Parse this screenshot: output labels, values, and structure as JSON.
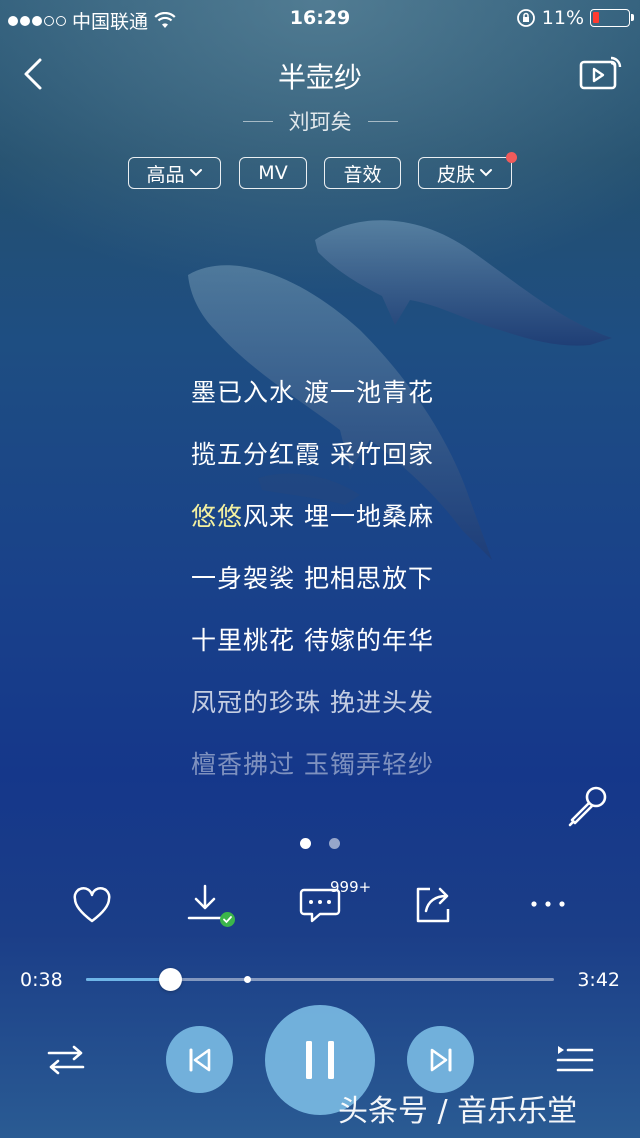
{
  "status_bar": {
    "carrier": "中国联通",
    "time": "16:29",
    "battery": "11%"
  },
  "song": {
    "title": "半壶纱",
    "artist": "刘珂矣"
  },
  "options": [
    {
      "label": "高品",
      "has_dropdown": true
    },
    {
      "label": "MV",
      "has_dropdown": false
    },
    {
      "label": "音效",
      "has_dropdown": false
    },
    {
      "label": "皮肤",
      "has_dropdown": true,
      "notification": true
    }
  ],
  "lyrics": [
    {
      "pre": "",
      "hl": "",
      "text": "墨已入水 渡一池青花",
      "color": "#ffffff"
    },
    {
      "pre": "",
      "hl": "",
      "text": "揽五分红霞 采竹回家",
      "color": "#ffffff"
    },
    {
      "pre": "",
      "hl": "悠悠",
      "text": "风来 埋一地桑麻",
      "color": "#ffffff"
    },
    {
      "pre": "",
      "hl": "",
      "text": "一身袈裟 把相思放下",
      "color": "#ffffff"
    },
    {
      "pre": "",
      "hl": "",
      "text": "十里桃花 待嫁的年华",
      "color": "#ffffff"
    },
    {
      "pre": "",
      "hl": "",
      "text": "凤冠的珍珠 挽进头发",
      "color": "rgba(255,255,255,0.75)"
    },
    {
      "pre": "",
      "hl": "",
      "text": "檀香拂过 玉镯弄轻纱",
      "color": "rgba(255,255,255,0.45)"
    }
  ],
  "pager": {
    "count": 2,
    "active": 0
  },
  "actions": {
    "comment_badge": "999+",
    "icons": [
      "heart-icon",
      "download-icon",
      "comment-icon",
      "share-icon",
      "more-icon"
    ]
  },
  "progress": {
    "current": "0:38",
    "total": "3:42",
    "played_fraction": 0.18,
    "buffered_fraction": 0.345
  },
  "watermark": "头条号 / 音乐乐堂",
  "colors": {
    "accent": "#6fb6e8",
    "highlight_lyric": "#f3f0a0",
    "button": "#78b9e2"
  }
}
